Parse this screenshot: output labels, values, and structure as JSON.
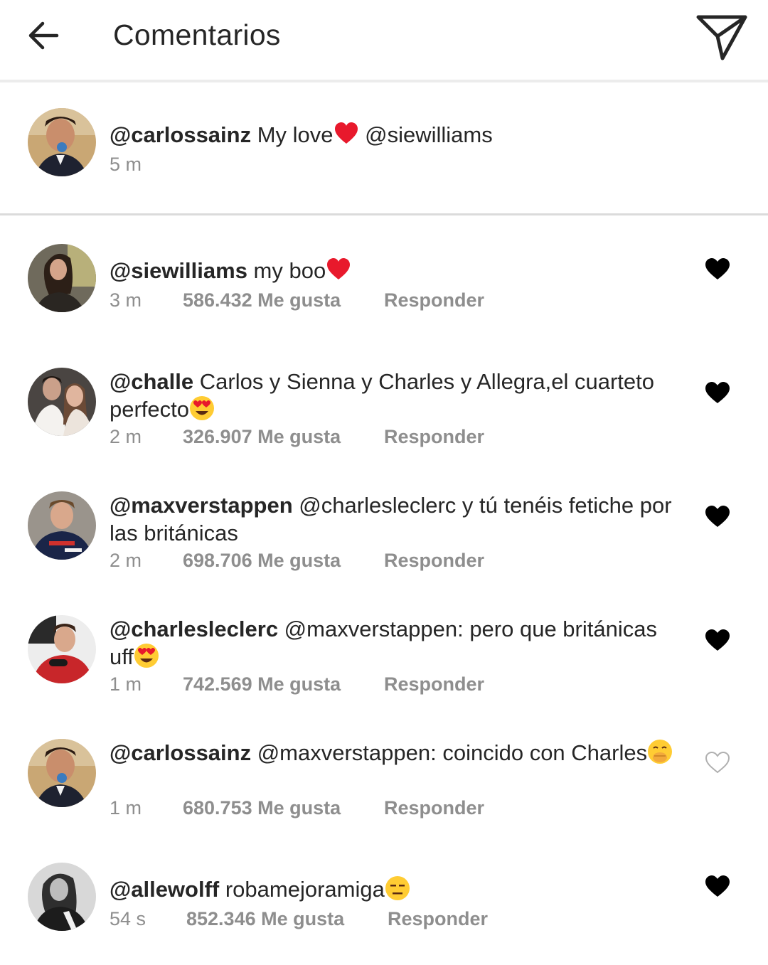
{
  "header": {
    "title": "Comentarios",
    "back_icon": "arrow-left-icon",
    "send_icon": "paper-plane-icon"
  },
  "caption": {
    "username": "@carlossainz",
    "text_before": " My love",
    "text_after": " @siewilliams",
    "time": "5 m"
  },
  "comments": [
    {
      "username": "@siewilliams",
      "text": " my boo",
      "time": "3 m",
      "likes": "586.432 Me gusta",
      "reply": "Responder",
      "liked": true
    },
    {
      "username": "@challe",
      "text": " Carlos y Sienna y Charles y Allegra,el cuarteto perfecto",
      "time": "2 m",
      "likes": "326.907 Me gusta",
      "reply": "Responder",
      "liked": true
    },
    {
      "username": "@maxverstappen",
      "text": " @charlesleclerc y tú tenéis fetiche por las británicas",
      "time": "2 m",
      "likes": "698.706 Me gusta",
      "reply": "Responder",
      "liked": true
    },
    {
      "username": "@charlesleclerc",
      "text": " @maxverstappen: pero que británicas uff",
      "time": "1 m",
      "likes": "742.569 Me gusta",
      "reply": "Responder",
      "liked": true
    },
    {
      "username": "@carlossainz",
      "text": " @maxverstappen: coincido con Charles",
      "time": "1 m",
      "likes": "680.753 Me gusta",
      "reply": "Responder",
      "liked": false
    },
    {
      "username": "@allewolff",
      "text": " robamejoramiga",
      "time": "54 s",
      "likes": "852.346 Me gusta",
      "reply": "Responder",
      "liked": true
    }
  ],
  "colors": {
    "text": "#262626",
    "secondary": "#8e8e8e",
    "heart_liked": "#000000",
    "heart_empty": "#b0b0b0",
    "emoji_heart": "#e8192c",
    "emoji_face": "#ffcc33"
  }
}
